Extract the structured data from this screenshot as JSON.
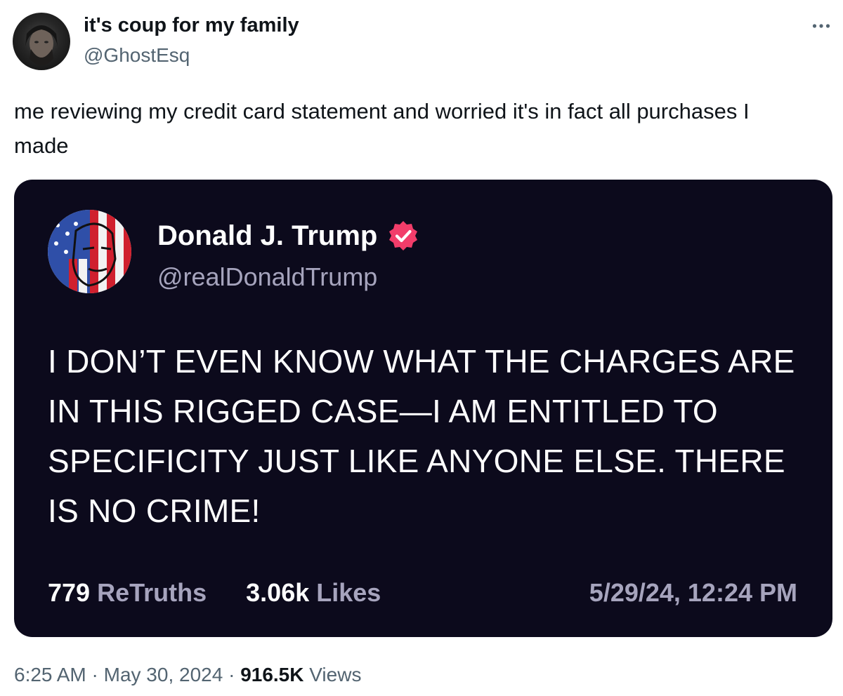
{
  "author": {
    "name": "it's coup for my family",
    "handle": "@GhostEsq",
    "avatar_icon": "profile-photo"
  },
  "more_icon": "ellipsis-icon",
  "tweet_text": "me reviewing my credit card statement and worried it's in fact all purchases I made",
  "embedded_post": {
    "name": "Donald J. Trump",
    "handle": "@realDonaldTrump",
    "verified_icon": "verified-badge-icon",
    "verified_color": "#f23d6a",
    "body": "I DON’T EVEN KNOW WHAT THE CHARGES ARE IN THIS RIGGED CASE—I AM ENTITLED TO SPECIFICITY JUST LIKE ANYONE ELSE. THERE IS NO CRIME!",
    "retruths_count": "779",
    "retruths_label": "ReTruths",
    "likes_count": "3.06k",
    "likes_label": "Likes",
    "date": "5/29/24, 12:24 PM",
    "background_color": "#0c0a1c"
  },
  "footer": {
    "time": "6:25 AM",
    "separator": "·",
    "date": "May 30, 2024",
    "views_count": "916.5K",
    "views_label": "Views"
  }
}
